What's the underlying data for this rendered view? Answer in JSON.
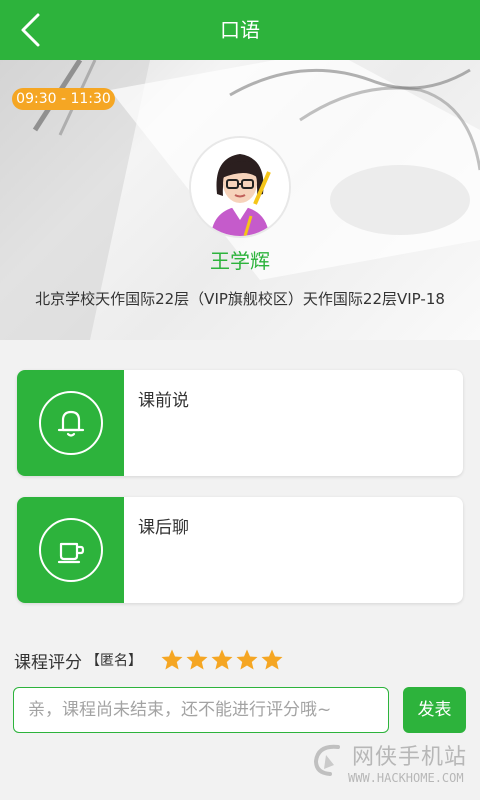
{
  "header": {
    "title": "口语",
    "back_icon": "chevron-left-icon"
  },
  "lesson": {
    "time_range": "09:30 - 11:30",
    "teacher_name": "王学辉",
    "location": "北京学校天作国际22层（VIP旗舰校区）天作国际22层VIP-18"
  },
  "cards": [
    {
      "label": "课前说",
      "icon": "bell-icon"
    },
    {
      "label": "课后聊",
      "icon": "cup-icon"
    }
  ],
  "rating": {
    "label": "课程评分",
    "anonymous": "【匿名】",
    "stars": 5,
    "max_stars": 5
  },
  "comment": {
    "placeholder": "亲，课程尚未结束，还不能进行评分哦~",
    "value": ""
  },
  "submit": {
    "label": "发表"
  },
  "watermark": {
    "cn": "网侠手机站",
    "en": "WWW.HACKHOME.COM"
  },
  "colors": {
    "primary": "#2db33c",
    "badge": "#f5a623",
    "star": "#f5a623"
  }
}
